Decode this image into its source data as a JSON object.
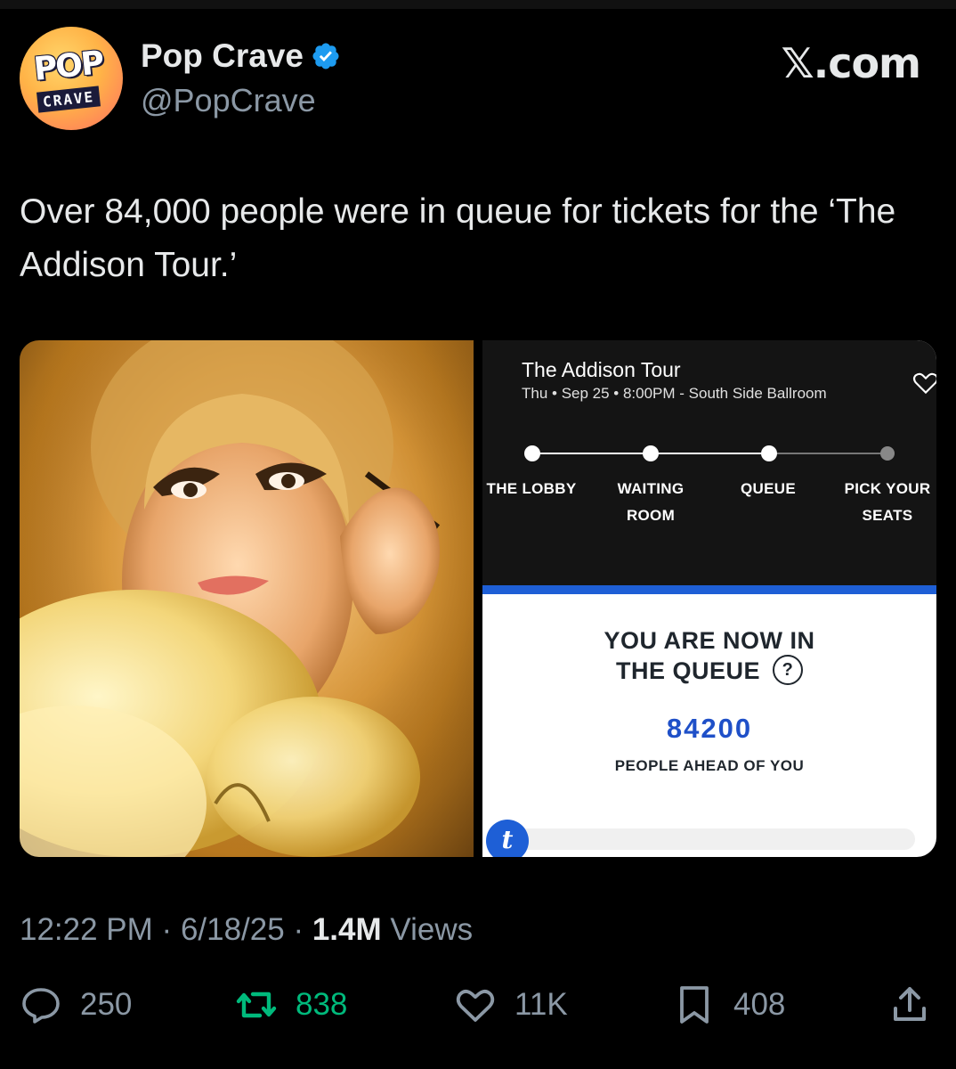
{
  "header": {
    "avatar_logo_top": "POP",
    "avatar_logo_bottom": "CRAVE",
    "display_name": "Pop Crave",
    "handle": "@PopCrave",
    "site": "𝕏.com"
  },
  "tweet": {
    "text": "Over 84,000 people were in queue for tickets for the ‘The Addison Tour.’"
  },
  "ticket_screen": {
    "event_title": "The Addison Tour",
    "event_subtitle": "Thu • Sep 25 • 8:00PM - South Side Ballroom",
    "steps": [
      "THE LOBBY",
      "WAITING ROOM",
      "QUEUE",
      "PICK YOUR SEATS"
    ],
    "queue_line1": "YOU ARE NOW IN",
    "queue_line2": "THE QUEUE",
    "help_glyph": "?",
    "queue_count": "84200",
    "queue_ahead_label": "PEOPLE AHEAD OF YOU",
    "brand_glyph": "t",
    "accent_color": "#1e5fd6"
  },
  "meta": {
    "time": "12:22 PM",
    "date": "6/18/25",
    "views_count": "1.4M",
    "views_label": "Views"
  },
  "actions": {
    "replies": "250",
    "reposts": "838",
    "likes": "11K",
    "bookmarks": "408"
  },
  "colors": {
    "background": "#000000",
    "text": "#e7e9ea",
    "muted": "#8b98a5",
    "verified": "#1d9bf0",
    "repost_active": "#00ba7c"
  }
}
